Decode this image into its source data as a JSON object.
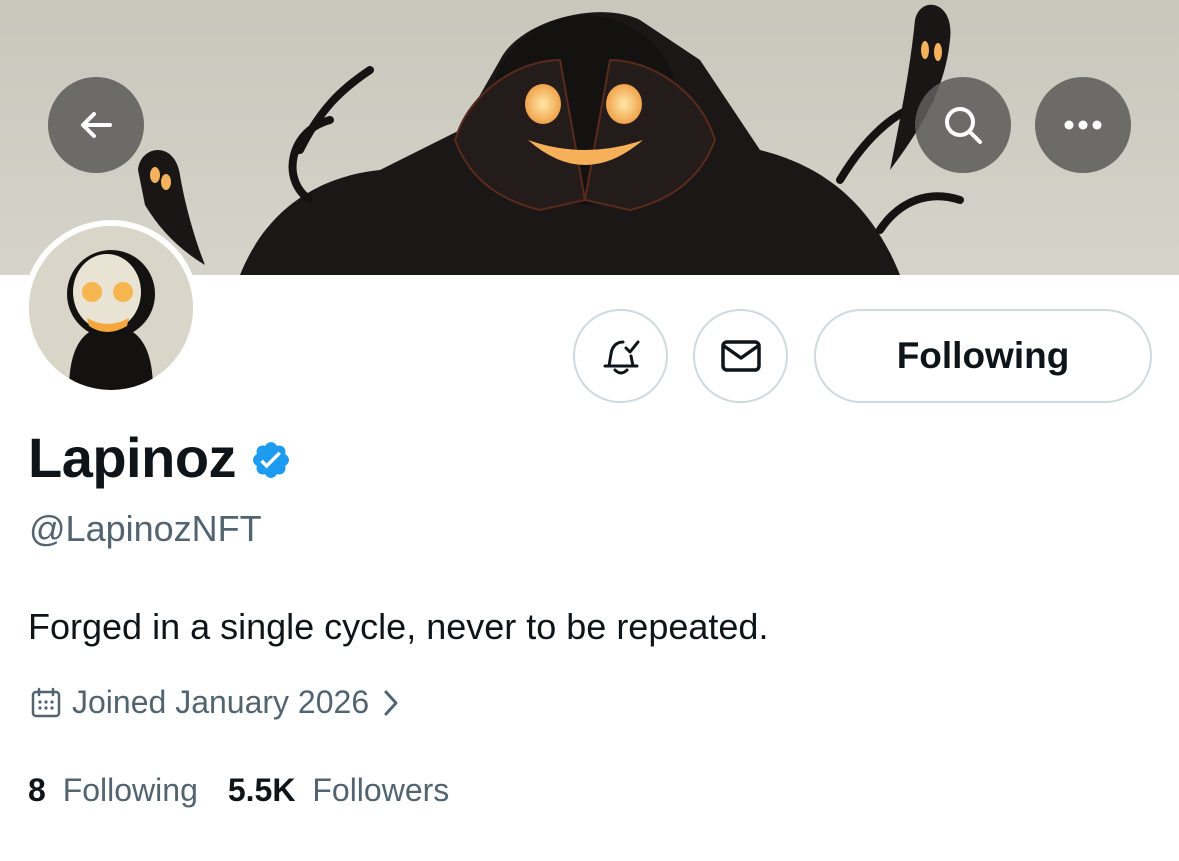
{
  "header": {
    "back_icon": "arrow-left-icon",
    "search_icon": "search-icon",
    "more_icon": "more-horizontal-icon"
  },
  "actions": {
    "notify_icon": "bell-check-icon",
    "message_icon": "envelope-icon",
    "following_label": "Following"
  },
  "profile": {
    "name": "Lapinoz",
    "verified_icon": "verified-badge-icon",
    "handle": "@LapinozNFT",
    "bio": "Forged in a single cycle, never to be repeated.",
    "joined": "Joined January 2026"
  },
  "stats": {
    "following_count": "8",
    "following_label": "Following",
    "followers_count": "5.5K",
    "followers_label": "Followers"
  },
  "colors": {
    "verified": "#1d9bf0",
    "secondary_text": "#536471",
    "banner_bg": "#cfcdc2"
  }
}
